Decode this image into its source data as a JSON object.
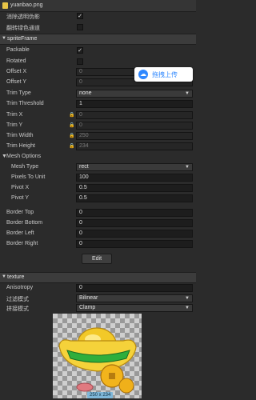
{
  "header": {
    "filename": "yuanbao.png"
  },
  "top_rows": [
    {
      "label": "消除透明伪影",
      "checked": true
    },
    {
      "label": "翻转绿色通道",
      "checked": false
    }
  ],
  "sprite_frame": {
    "title": "spriteFrame",
    "packable": {
      "label": "Packable",
      "checked": true
    },
    "rotated": {
      "label": "Rotated",
      "checked": false
    },
    "offset_x": {
      "label": "Offset X",
      "value": "0"
    },
    "offset_y": {
      "label": "Offset Y",
      "value": "0"
    },
    "trim_type": {
      "label": "Trim Type",
      "value": "none"
    },
    "trim_threshold": {
      "label": "Trim Threshold",
      "value": "1"
    },
    "trim_x": {
      "label": "Trim X",
      "value": "0"
    },
    "trim_y": {
      "label": "Trim Y",
      "value": "0"
    },
    "trim_width": {
      "label": "Trim Width",
      "value": "250"
    },
    "trim_height": {
      "label": "Trim Height",
      "value": "234"
    },
    "mesh_options": {
      "label": "Mesh Options"
    },
    "mesh_type": {
      "label": "Mesh Type",
      "value": "rect"
    },
    "pixels_to_unit": {
      "label": "Pixels To Unit",
      "value": "100"
    },
    "pivot_x": {
      "label": "Pivot X",
      "value": "0.5"
    },
    "pivot_y": {
      "label": "Pivot Y",
      "value": "0.5"
    },
    "border_top": {
      "label": "Border Top",
      "value": "0"
    },
    "border_bottom": {
      "label": "Border Bottom",
      "value": "0"
    },
    "border_left": {
      "label": "Border Left",
      "value": "0"
    },
    "border_right": {
      "label": "Border Right",
      "value": "0"
    },
    "edit_label": "Edit"
  },
  "upload_button": {
    "label": "拖拽上传",
    "icon": "cloud-upload-icon",
    "color": "#2f88ff"
  },
  "texture": {
    "title": "texture",
    "anisotropy": {
      "label": "Anisotropy",
      "value": "0"
    },
    "filter_mode": {
      "label": "过滤模式",
      "value": "Bilinear"
    },
    "wrap_mode": {
      "label": "拼接模式",
      "value": "Clamp"
    }
  },
  "preview": {
    "dimensions": "250 x 234"
  }
}
